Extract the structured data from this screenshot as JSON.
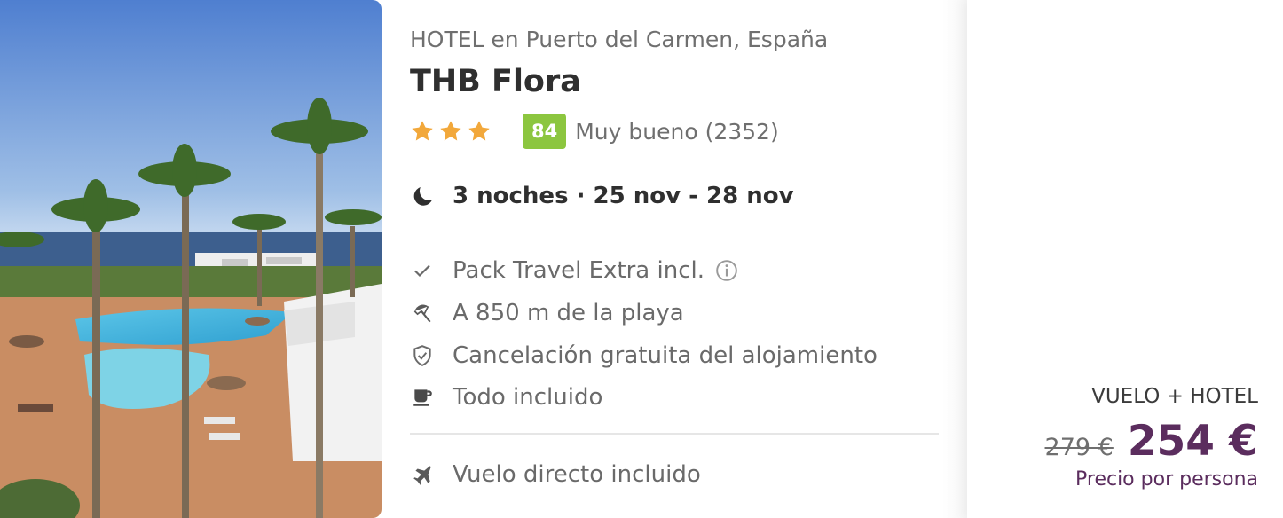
{
  "hotel": {
    "location": "HOTEL en Puerto del Carmen, España",
    "name": "THB Flora",
    "stars": 3,
    "score": "84",
    "score_text": "Muy bueno (2352)",
    "score_color": "#8cc63f",
    "star_color": "#f2a83b"
  },
  "stay": {
    "icon": "moon-icon",
    "text": "3 noches · 25 nov - 28 nov"
  },
  "features": [
    {
      "icon": "check-icon",
      "text": "Pack Travel Extra incl.",
      "has_info": true
    },
    {
      "icon": "beach-umbrella-icon",
      "text": "A 850 m de la playa"
    },
    {
      "icon": "shield-check-icon",
      "text": "Cancelación gratuita del alojamiento"
    },
    {
      "icon": "coffee-cup-icon",
      "text": "Todo incluido"
    },
    {
      "icon": "airplane-icon",
      "text": "Vuelo directo incluido"
    }
  ],
  "pricing": {
    "product_type": "VUELO + HOTEL",
    "old_price": "279 €",
    "new_price": "254 €",
    "per_person": "Precio por persona",
    "accent_color": "#5b2d5e"
  }
}
